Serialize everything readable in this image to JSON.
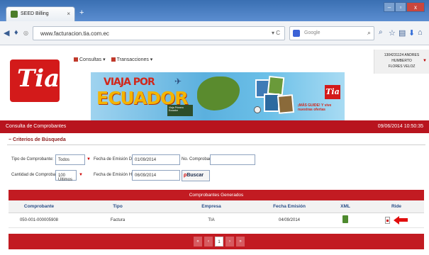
{
  "browser": {
    "tab_title": "SEED Billing",
    "tab_close": "×",
    "new_tab": "+",
    "url": "www.facturacion.tia.com.ec",
    "url_controls": "▾ C",
    "search_placeholder": "Google",
    "window_buttons": [
      "–",
      "▫",
      "x"
    ]
  },
  "header": {
    "logo_text": "Tia",
    "menu": [
      {
        "label": "Consultas ▾"
      },
      {
        "label": "Transacciones ▾"
      }
    ],
    "user": {
      "line1": "1304231124 ANDRES HUMBERTO",
      "line2": "FLORES VELOZ"
    },
    "banner": {
      "title1": "VIAJA POR",
      "title2": "ECUADOR",
      "sign_text": "Viaja Primero Ecuador",
      "logo_text": "Tia",
      "subtitle": "¡MÁS GUIDE! Y vive nuestras ofertas"
    }
  },
  "redbar": {
    "title": "Consulta de Comprobantes",
    "datetime": "09/06/2014 10:50:35"
  },
  "criteria": {
    "section_title": "Criterios de Búsqueda",
    "tipo_label": "Tipo de Comprobante:",
    "tipo_value": "Todos",
    "cantidad_label": "Cantidad de Comprobantes:",
    "cantidad_value": "100 Últimos",
    "desde_label": "Fecha de Emisión Desde:",
    "desde_value": "01/09/2014",
    "hasta_label": "Fecha de Emisión Hasta:",
    "hasta_value": "06/09/2014",
    "numero_label": "No. Comprobante:",
    "numero_value": "",
    "buscar_label": "Buscar"
  },
  "results": {
    "header": "Comprobantes Generados",
    "columns": [
      "Comprobante",
      "Tipo",
      "Empresa",
      "Fecha Emisión",
      "XML",
      "Ride"
    ],
    "rows": [
      {
        "comprobante": "050-001-000005908",
        "tipo": "Factura",
        "empresa": "TIA",
        "fecha": "04/09/2014"
      }
    ]
  },
  "pager": {
    "buttons": [
      "«",
      "‹",
      "1",
      "›",
      "»"
    ],
    "current_page": "1"
  }
}
